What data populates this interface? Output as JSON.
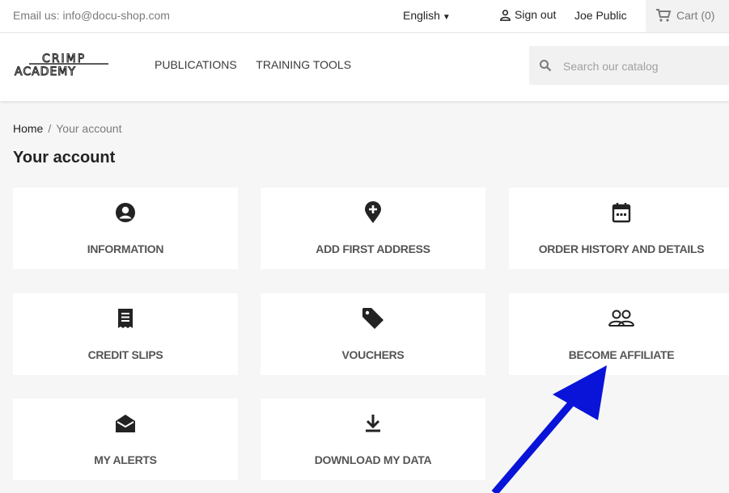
{
  "topbar": {
    "email": "Email us: info@docu-shop.com",
    "language": "English",
    "signout": "Sign out",
    "user_name": "Joe Public",
    "cart": "Cart (0)"
  },
  "header": {
    "logo_line1": "CRIMP",
    "logo_line2": "ACADEMY",
    "nav": [
      "PUBLICATIONS",
      "TRAINING TOOLS"
    ],
    "search_placeholder": "Search our catalog"
  },
  "breadcrumb": {
    "home": "Home",
    "separator": "/",
    "current": "Your account"
  },
  "page_title": "Your account",
  "tiles": [
    {
      "label": "INFORMATION",
      "icon": "user-circle-icon"
    },
    {
      "label": "ADD FIRST ADDRESS",
      "icon": "location-plus-icon"
    },
    {
      "label": "ORDER HISTORY AND DETAILS",
      "icon": "calendar-icon"
    },
    {
      "label": "CREDIT SLIPS",
      "icon": "receipt-icon"
    },
    {
      "label": "VOUCHERS",
      "icon": "tag-icon"
    },
    {
      "label": "BECOME AFFILIATE",
      "icon": "people-icon"
    },
    {
      "label": "MY ALERTS",
      "icon": "envelope-open-icon"
    },
    {
      "label": "DOWNLOAD MY DATA",
      "icon": "download-icon"
    }
  ],
  "colors": {
    "annotation_arrow": "#0a14d8",
    "page_bg": "#f6f6f6",
    "icon": "#232323"
  }
}
